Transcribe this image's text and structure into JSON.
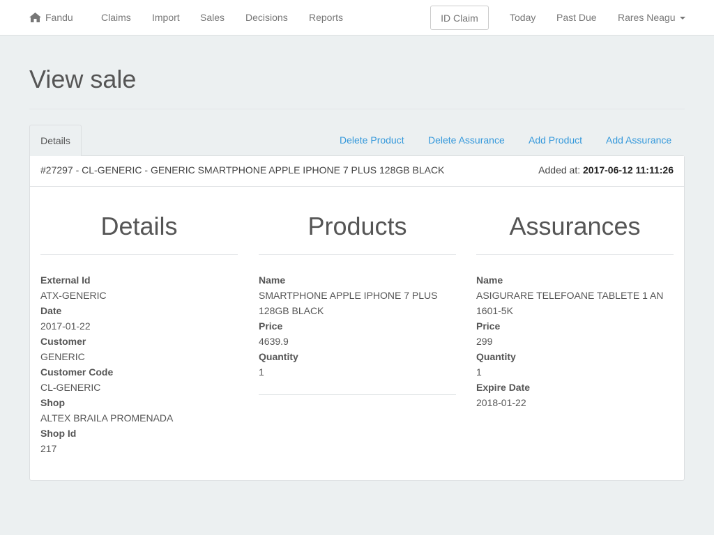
{
  "nav": {
    "brand": "Fandu",
    "links": [
      "Claims",
      "Import",
      "Sales",
      "Decisions",
      "Reports"
    ],
    "id_claim_placeholder": "ID Claim",
    "right_links": [
      "Today",
      "Past Due"
    ],
    "user": "Rares Neagu",
    "brand_icon": "home-icon"
  },
  "page": {
    "title": "View sale"
  },
  "tabs": {
    "active": "Details",
    "actions": [
      "Delete Product",
      "Delete Assurance",
      "Add Product",
      "Add Assurance"
    ]
  },
  "sale": {
    "heading": "#27297 - CL-GENERIC - GENERIC SMARTPHONE APPLE IPHONE 7 PLUS 128GB BLACK",
    "added_label": "Added at:",
    "added_value": "2017-06-12 11:11:26"
  },
  "details": {
    "title": "Details",
    "fields": [
      {
        "label": "External Id",
        "value": "ATX-GENERIC"
      },
      {
        "label": "Date",
        "value": "2017-01-22"
      },
      {
        "label": "Customer",
        "value": "GENERIC"
      },
      {
        "label": "Customer Code",
        "value": "CL-GENERIC"
      },
      {
        "label": "Shop",
        "value": "ALTEX BRAILA PROMENADA"
      },
      {
        "label": "Shop Id",
        "value": "217"
      }
    ]
  },
  "products": {
    "title": "Products",
    "fields": [
      {
        "label": "Name",
        "value": "SMARTPHONE APPLE IPHONE 7 PLUS 128GB BLACK"
      },
      {
        "label": "Price",
        "value": "4639.9"
      },
      {
        "label": "Quantity",
        "value": "1"
      }
    ]
  },
  "assurances": {
    "title": "Assurances",
    "fields": [
      {
        "label": "Name",
        "value": "ASIGURARE TELEFOANE TABLETE 1 AN 1601-5K"
      },
      {
        "label": "Price",
        "value": "299"
      },
      {
        "label": "Quantity",
        "value": "1"
      },
      {
        "label": "Expire Date",
        "value": "2018-01-22"
      }
    ]
  },
  "colors": {
    "link": "#3498db",
    "page_bg": "#ecf0f1",
    "nav_text": "#777777"
  }
}
